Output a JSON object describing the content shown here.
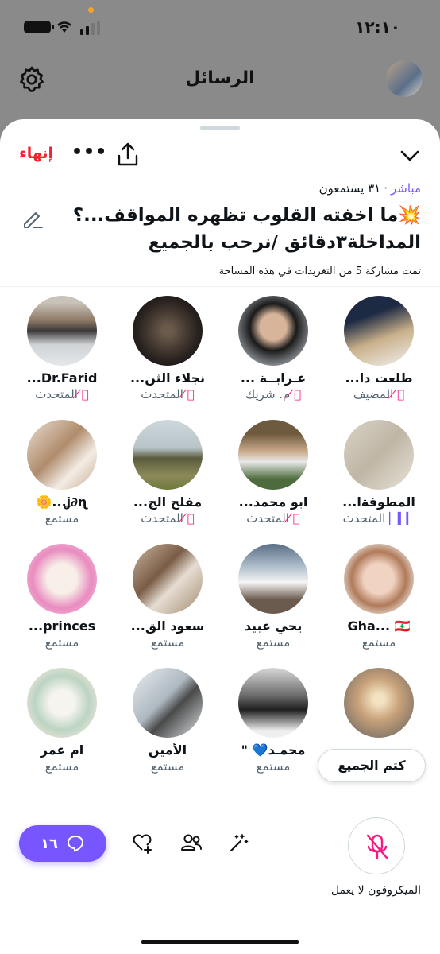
{
  "status_bar": {
    "time": "١٢:١٠"
  },
  "header": {
    "title": "الرسائل"
  },
  "space": {
    "end_label": "إنهاء",
    "live_label": "مباشر",
    "separator": "·",
    "listeners": "٣١ يستمعون",
    "title_line1": "💥ما اخفته القلوب تظهره المواقف...؟",
    "title_line2": "المداخلة٣دقائق /نرحب بالجميع",
    "shared_note": "تمت مشاركة 5 من التغريدات في هذه المساحة"
  },
  "participants": [
    {
      "name": "طلعت دا...",
      "role": "المضيف",
      "status": "muted"
    },
    {
      "name": "ع͏ـ͏ر͏ابـ͏ـة ...",
      "role": "م. شريك",
      "status": "muted"
    },
    {
      "name": "نجلاء الثن...",
      "role": "المتحدث",
      "status": "muted"
    },
    {
      "name": "Dr.Farid...",
      "role": "المتحدث",
      "status": "muted"
    },
    {
      "name": "المطوفةا...",
      "role": "المتحدث",
      "status": "speaking"
    },
    {
      "name": "ابو محمد...",
      "role": "المتحدث",
      "status": "muted"
    },
    {
      "name": "مفلح الج...",
      "role": "المتحدث",
      "status": "muted"
    },
    {
      "name": "ʝ∂ɳ...🌼",
      "role": "مستمع",
      "status": "none"
    },
    {
      "name": "Gha... 🇱🇧",
      "role": "مستمع",
      "status": "none"
    },
    {
      "name": "يحي عبيد",
      "role": "مستمع",
      "status": "none"
    },
    {
      "name": "سعود الق...",
      "role": "مستمع",
      "status": "none"
    },
    {
      "name": "princes...",
      "role": "مستمع",
      "status": "none"
    },
    {
      "name": "",
      "role": "",
      "status": "none"
    },
    {
      "name": "محمـد💙 \"",
      "role": "مستمع",
      "status": "none"
    },
    {
      "name": "الأمين",
      "role": "مستمع",
      "status": "none"
    },
    {
      "name": "ام عمر",
      "role": "مستمع",
      "status": "none"
    }
  ],
  "mute_all_label": "كتم الجميع",
  "comments_count": "١٦",
  "mic_status": "الميكروفون لا يعمل",
  "icons": {
    "settings": "gear-icon",
    "collapse": "chevron-down-icon",
    "share": "share-icon",
    "more": "more-icon",
    "edit": "pencil-icon",
    "muted": "mic-off-icon",
    "speaking": "speaking-bars-icon",
    "comments": "chat-bubble-icon",
    "add_heart": "heart-plus-icon",
    "people": "people-icon",
    "sparkle": "magic-wand-icon",
    "mic": "mic-off-icon"
  },
  "colors": {
    "accent": "#7856ff",
    "danger": "#f4212e",
    "mute": "#f91880"
  }
}
